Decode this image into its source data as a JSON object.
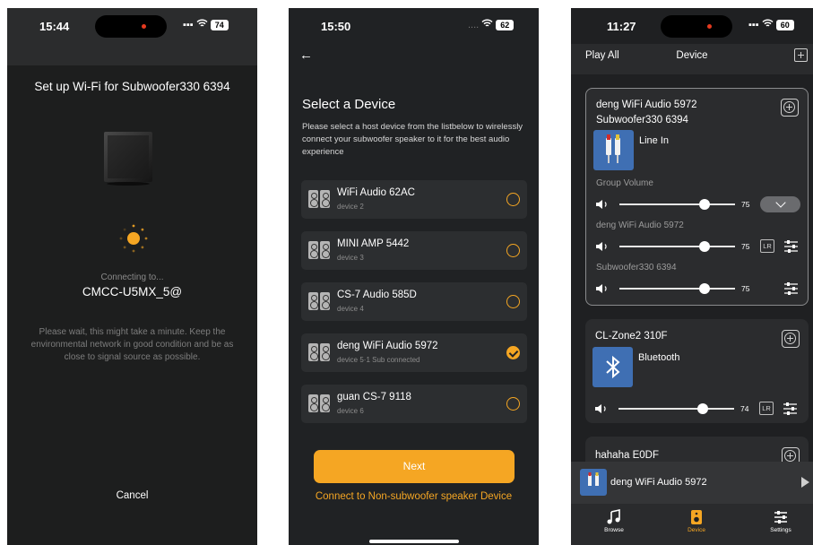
{
  "screen1": {
    "status": {
      "time": "15:44",
      "battery": "74"
    },
    "title": "Set up Wi-Fi for Subwoofer330 6394",
    "connecting_label": "Connecting to...",
    "ssid": "CMCC-U5MX_5@",
    "wait_message": "Please wait, this might take a minute. Keep the environmental network in good condition and be as close to signal source as possible.",
    "cancel_label": "Cancel"
  },
  "screen2": {
    "status": {
      "time": "15:50",
      "battery": "62"
    },
    "heading": "Select a Device",
    "description": "Please select a host device from the listbelow to wirelessly connect your subwoofer speaker to it for the best audio experience",
    "devices": [
      {
        "name": "WiFi Audio 62AC",
        "sub": "device 2",
        "selected": false
      },
      {
        "name": "MINI AMP 5442",
        "sub": "device 3",
        "selected": false
      },
      {
        "name": "CS-7 Audio 585D",
        "sub": "device 4",
        "selected": false
      },
      {
        "name": "deng WiFi Audio 5972",
        "sub": "device 5·1 Sub connected",
        "selected": true
      },
      {
        "name": "guan CS-7 9118",
        "sub": "device 6",
        "selected": false
      }
    ],
    "next_label": "Next",
    "non_sub_link": "Connect to Non-subwoofer speaker Device"
  },
  "screen3": {
    "status": {
      "time": "11:27",
      "battery": "60"
    },
    "play_all": "Play All",
    "title": "Device",
    "group_card": {
      "title_line1": "deng WiFi Audio 5972",
      "title_line2": "Subwoofer330 6394",
      "source": "Line In",
      "group_volume_label": "Group Volume",
      "group_volume": "75",
      "members": [
        {
          "name": "deng WiFi Audio 5972",
          "volume": "75",
          "lr": "LR"
        },
        {
          "name": "Subwoofer330 6394",
          "volume": "75"
        }
      ]
    },
    "zone_card": {
      "title": "CL-Zone2 310F",
      "source": "Bluetooth",
      "volume": "74",
      "lr": "LR"
    },
    "partial_card": {
      "title": "hahaha E0DF"
    },
    "now_playing": "deng WiFi Audio 5972",
    "tabs": [
      {
        "label": "Browse",
        "icon": "music-note-icon"
      },
      {
        "label": "Device",
        "icon": "speaker-icon",
        "active": true
      },
      {
        "label": "Settings",
        "icon": "sliders-icon"
      }
    ],
    "accent_color": "#f5a623"
  }
}
